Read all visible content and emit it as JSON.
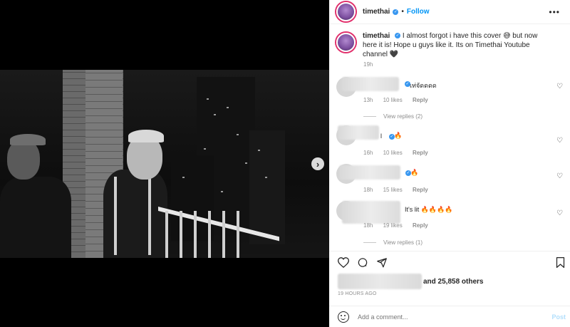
{
  "post": {
    "username": "timethai",
    "follow_label": "Follow",
    "more_label": "•••",
    "caption": "I almost forgot i have this cover 😅 but now here it is! Hope u guys like it. Its on Timethai Youtube channel 🖤",
    "caption_time": "19h"
  },
  "comments": [
    {
      "text": "เท่จัดดดด",
      "time": "13h",
      "likes": "10 likes",
      "reply": "Reply",
      "view_replies": "View replies (2)"
    },
    {
      "text": "l",
      "time": "16h",
      "likes": "10 likes",
      "reply": "Reply"
    },
    {
      "text": "",
      "time": "18h",
      "likes": "15 likes",
      "reply": "Reply"
    },
    {
      "text": "It's lit 🔥🔥🔥🔥",
      "time": "18h",
      "likes": "19 likes",
      "reply": "Reply",
      "view_replies": "View replies (1)"
    }
  ],
  "actions": {
    "like_icon": "heart-icon",
    "comment_icon": "comment-icon",
    "share_icon": "share-icon",
    "save_icon": "bookmark-icon"
  },
  "likes_summary": "and 25,858 others",
  "post_age": "19 HOURS AGO",
  "add_comment": {
    "placeholder": "Add a comment...",
    "post_label": "Post"
  },
  "colors": {
    "accent": "#0095f6",
    "muted": "#8e8e8e",
    "text": "#262626"
  }
}
